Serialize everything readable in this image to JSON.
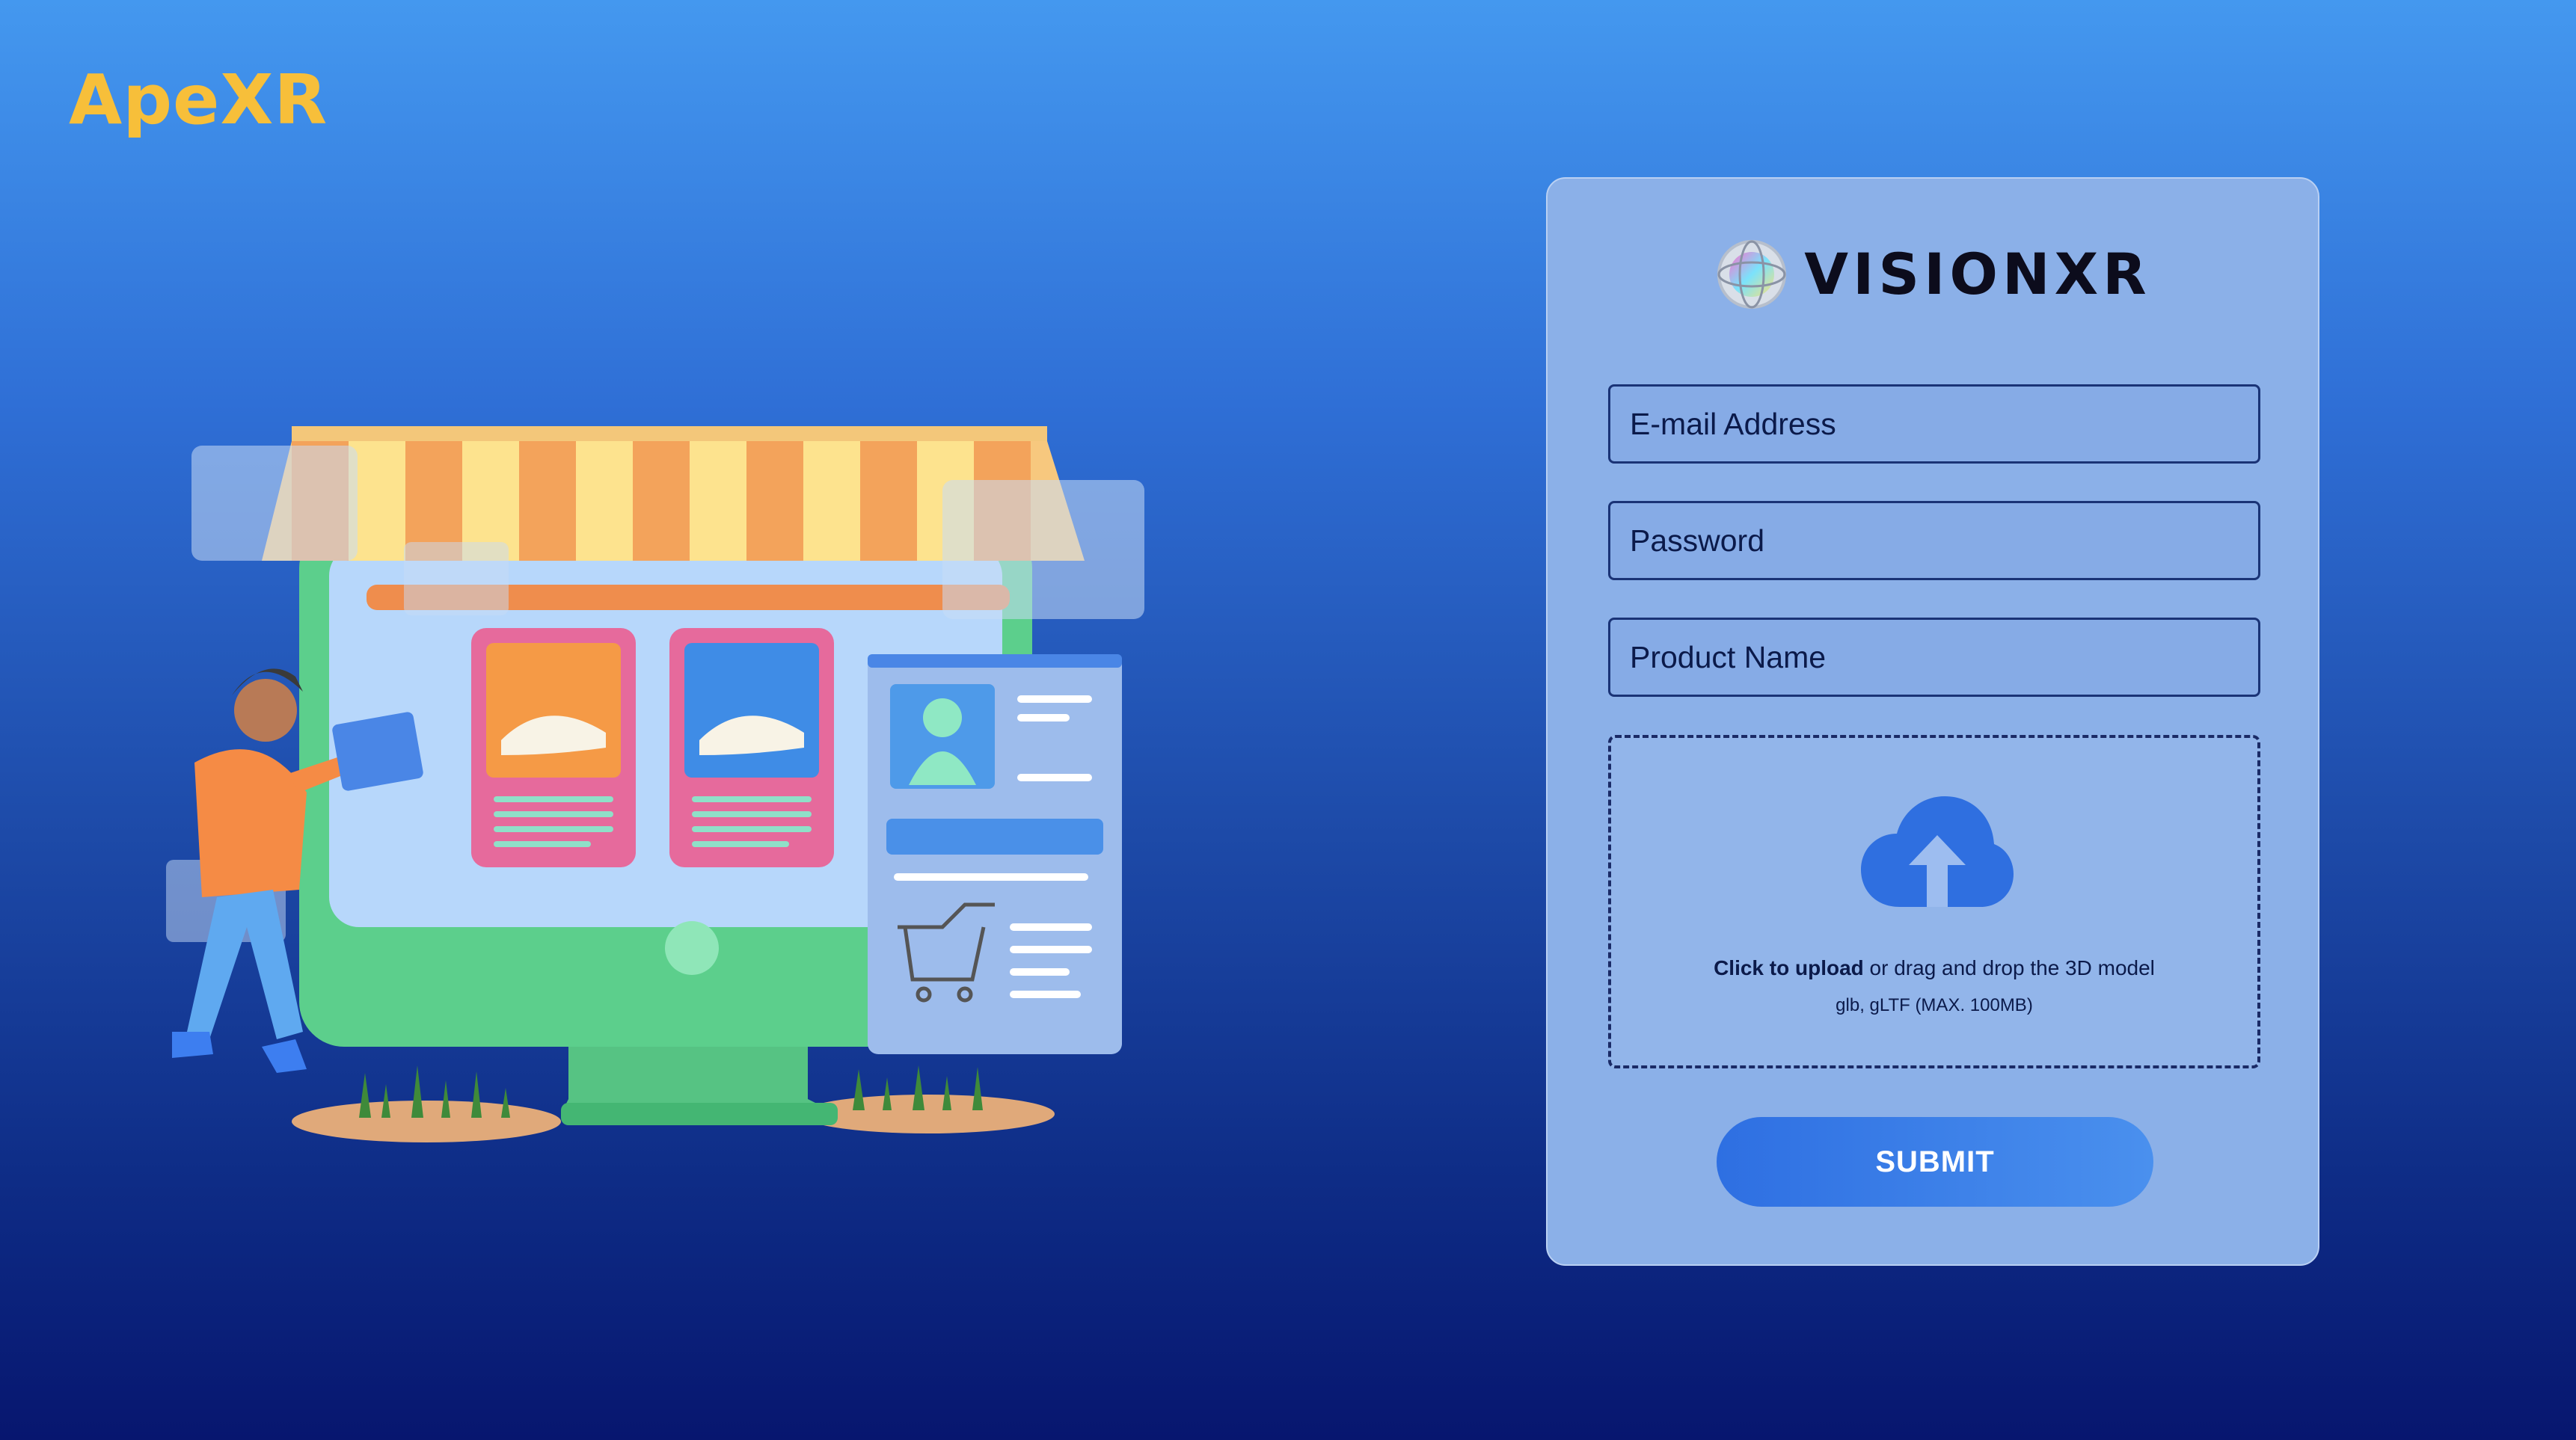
{
  "brand": {
    "name": "ApeXR",
    "color": "#f7bf3a"
  },
  "form": {
    "logo_text": "VISIONXR",
    "email_placeholder": "E-mail Address",
    "password_placeholder": "Password",
    "product_placeholder": "Product Name",
    "upload": {
      "icon": "cloud-upload-icon",
      "action_text": "Click to upload",
      "rest_text": " or drag and drop the 3D model",
      "hint": "glb, gLTF (MAX. 100MB)"
    },
    "submit_label": "SUBMIT"
  },
  "colors": {
    "background_top": "#4498ef",
    "background_bottom": "#07166f",
    "card": "#8bb0e8",
    "accent": "#2e6fe2"
  }
}
